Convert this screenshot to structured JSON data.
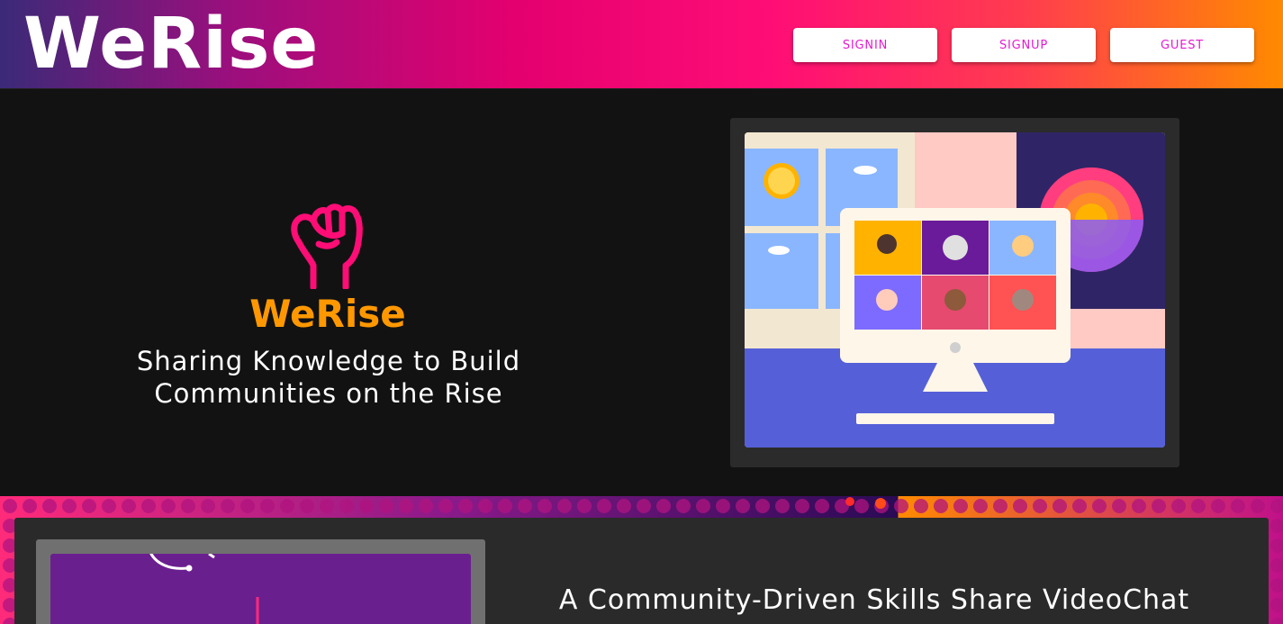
{
  "header": {
    "brand": "WeRise",
    "nav": {
      "signin": "SIGNIN",
      "signup": "SIGNUP",
      "guest": "GUEST"
    }
  },
  "hero": {
    "logo_text": "WeRise",
    "tagline_line1": "Sharing Knowledge to Build",
    "tagline_line2": "Communities on the Rise",
    "logo_icon": "raised-fist-icon",
    "illustration": "video-conference-illustration"
  },
  "features": {
    "title": "A Community-Driven Skills Share VideoChat",
    "illustration": "purple-illustration"
  },
  "colors": {
    "accent_pink": "#ff0d76",
    "accent_orange": "#ff9800",
    "button_text": "#e61ad1",
    "fist": "#ff0d76"
  }
}
